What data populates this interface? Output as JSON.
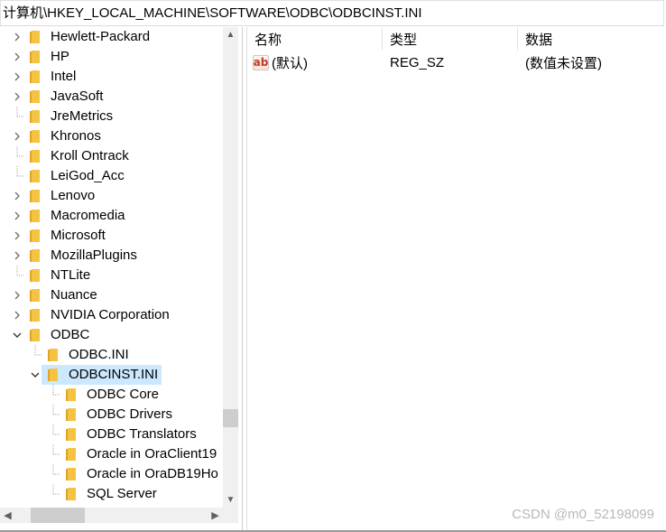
{
  "address_bar": {
    "path": "计算机\\HKEY_LOCAL_MACHINE\\SOFTWARE\\ODBC\\ODBCINST.INI"
  },
  "tree": {
    "items": [
      {
        "label": "Hewlett-Packard",
        "expander": "collapsed",
        "level": 1
      },
      {
        "label": "HP",
        "expander": "collapsed",
        "level": 1
      },
      {
        "label": "Intel",
        "expander": "collapsed",
        "level": 1
      },
      {
        "label": "JavaSoft",
        "expander": "collapsed",
        "level": 1
      },
      {
        "label": "JreMetrics",
        "expander": "none",
        "level": 1
      },
      {
        "label": "Khronos",
        "expander": "collapsed",
        "level": 1
      },
      {
        "label": "Kroll Ontrack",
        "expander": "none",
        "level": 1
      },
      {
        "label": "LeiGod_Acc",
        "expander": "none",
        "level": 1
      },
      {
        "label": "Lenovo",
        "expander": "collapsed",
        "level": 1
      },
      {
        "label": "Macromedia",
        "expander": "collapsed",
        "level": 1
      },
      {
        "label": "Microsoft",
        "expander": "collapsed",
        "level": 1
      },
      {
        "label": "MozillaPlugins",
        "expander": "collapsed",
        "level": 1
      },
      {
        "label": "NTLite",
        "expander": "none",
        "level": 1
      },
      {
        "label": "Nuance",
        "expander": "collapsed",
        "level": 1
      },
      {
        "label": "NVIDIA Corporation",
        "expander": "collapsed",
        "level": 1
      },
      {
        "label": "ODBC",
        "expander": "expanded",
        "level": 1
      },
      {
        "label": "ODBC.INI",
        "expander": "none",
        "level": 2
      },
      {
        "label": "ODBCINST.INI",
        "expander": "expanded",
        "level": 2,
        "selected": true
      },
      {
        "label": "ODBC Core",
        "expander": "none",
        "level": 3
      },
      {
        "label": "ODBC Drivers",
        "expander": "none",
        "level": 3
      },
      {
        "label": "ODBC Translators",
        "expander": "none",
        "level": 3
      },
      {
        "label": "Oracle in OraClient19",
        "expander": "none",
        "level": 3
      },
      {
        "label": "Oracle in OraDB19Ho",
        "expander": "none",
        "level": 3
      },
      {
        "label": "SQL Server",
        "expander": "none",
        "level": 3
      }
    ]
  },
  "values_list": {
    "columns": [
      "名称",
      "类型",
      "数据"
    ],
    "rows": [
      {
        "icon": "string-value-icon",
        "icon_text": "ab",
        "name": "(默认)",
        "type": "REG_SZ",
        "data": "(数值未设置)"
      }
    ]
  },
  "watermark": "CSDN @m0_52198099",
  "colors": {
    "selection": "#cce8ff",
    "folder": "#f5c342",
    "folder_dark": "#e0a526",
    "scrollbar_track": "#f0f0f0",
    "scrollbar_thumb": "#cdcdcd"
  }
}
